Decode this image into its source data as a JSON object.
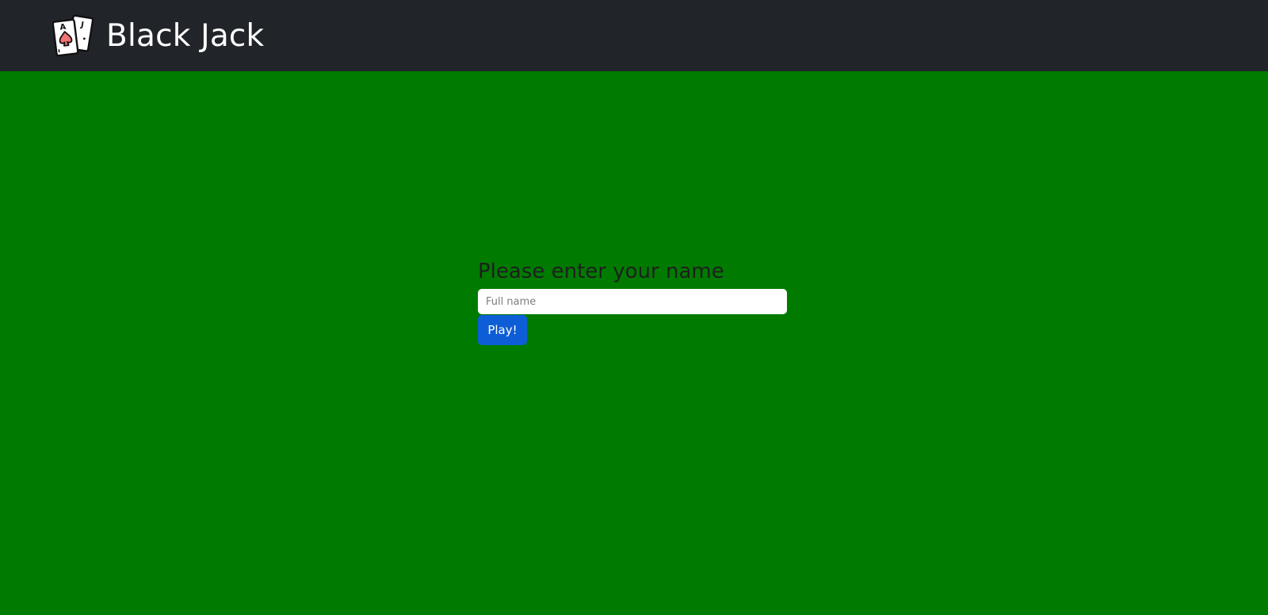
{
  "navbar": {
    "brand_name": "Black Jack",
    "logo_icon": "playing-cards-icon",
    "background_color": "#212529"
  },
  "page": {
    "background_color": "#007b00"
  },
  "form": {
    "title": "Please enter your name",
    "name_input": {
      "placeholder": "Full name",
      "value": ""
    },
    "play_button_label": "Play!",
    "button_color": "#0d5ed6"
  }
}
